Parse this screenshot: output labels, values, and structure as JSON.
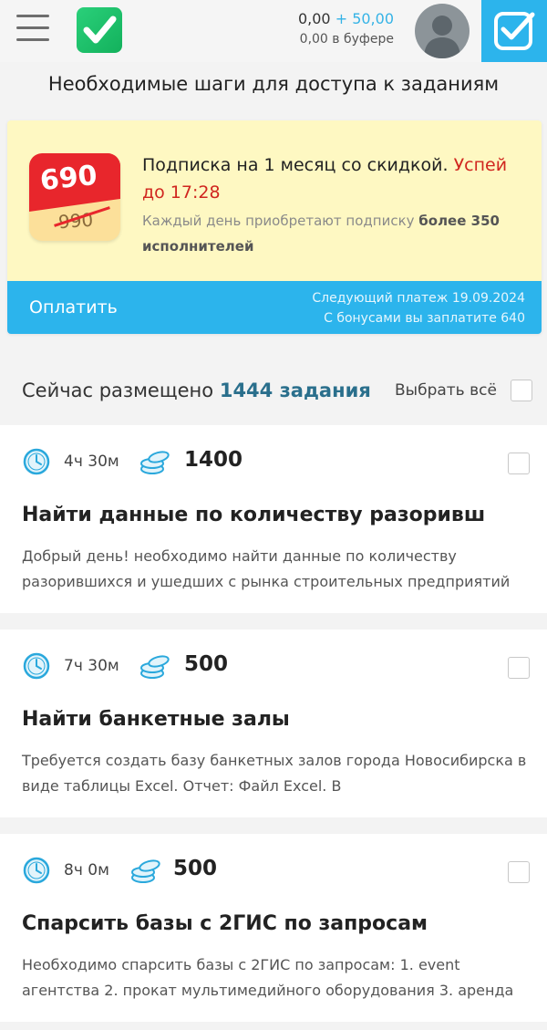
{
  "header": {
    "balance": "0,00",
    "bonus": "+ 50,00",
    "buffer": "0,00 в буфере",
    "colors": {
      "accent": "#2cb4ec",
      "logo": "#1cc06a"
    }
  },
  "page_title": "Необходимые шаги для доступа к заданиям",
  "promo": {
    "price_new": "690",
    "price_old": "990",
    "title": "Подписка на 1 месяц со скидкой.",
    "hurry": "Успей до 17:28",
    "sub_text": "Каждый день приобретают подписку",
    "sub_bold": "более 350 исполнителей",
    "pay_label": "Оплатить",
    "next_payment": "Следующий платеж 19.09.2024",
    "bonus_payment": "С бонусами вы заплатите 640"
  },
  "tasks_header": {
    "prefix": "Сейчас размещено",
    "count": "1444 задания",
    "select_all": "Выбрать всё"
  },
  "tasks": [
    {
      "time": "4ч 30м",
      "price": "1400",
      "title": "Найти данные по количеству разоривш",
      "description": "Добрый день! необходимо найти данные по количеству разорившихся и ушедших с рынка строительных предприятий"
    },
    {
      "time": "7ч 30м",
      "price": "500",
      "title": "Найти банкетные залы",
      "description": "Требуется создать базу банкетных залов города Новосибирска в виде таблицы Excel. Отчет: Файл Excel. В"
    },
    {
      "time": "8ч 0м",
      "price": "500",
      "title": "Спарсить базы с 2ГИС по запросам",
      "description": "Необходимо спарсить базы с 2ГИС по запросам: 1. event агентства 2. прокат мультимедийного оборудования 3. аренда"
    }
  ]
}
